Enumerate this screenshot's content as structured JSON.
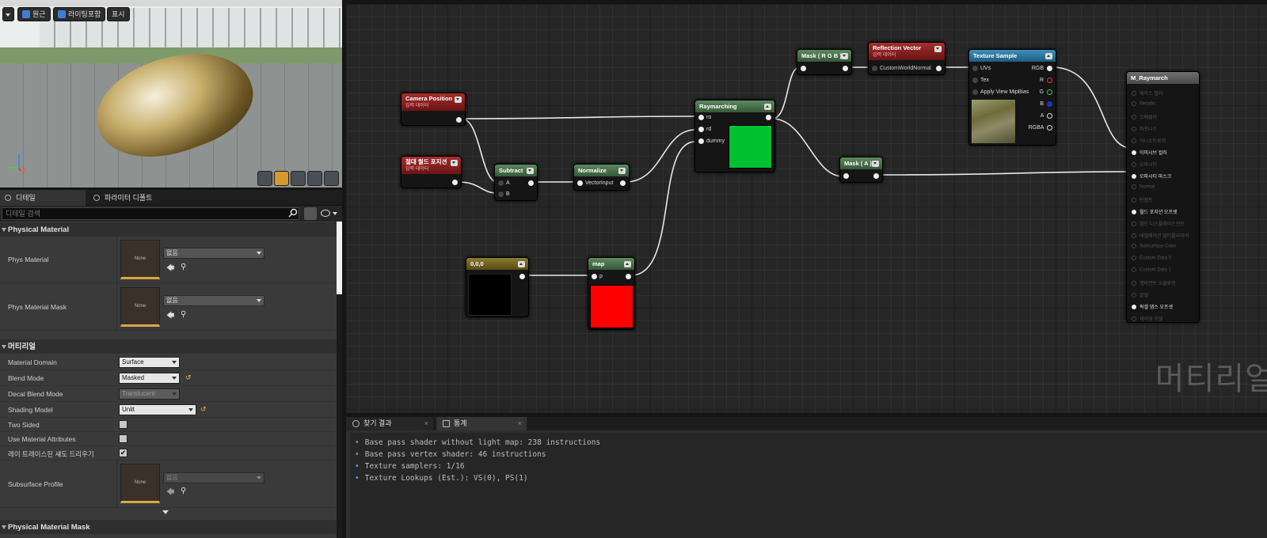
{
  "viewport": {
    "toolbar": {
      "perspective_label": "원근",
      "lighting_label": "라이팅포함",
      "show_label": "표시"
    },
    "axes": {
      "z": "Z",
      "x": "X"
    }
  },
  "panel_tabs": {
    "details": "디테일",
    "params": "파라미터 디폴트"
  },
  "search": {
    "placeholder": "디테일 검색"
  },
  "sections": {
    "physical_material": "Physical Material",
    "material": "머티리얼",
    "physical_material_mask": "Physical Material Mask"
  },
  "props": {
    "phys_material": {
      "label": "Phys Material",
      "thumb": "None",
      "value": "없음"
    },
    "phys_material_mask": {
      "label": "Phys Material Mask",
      "thumb": "None",
      "value": "없음"
    },
    "material_domain": {
      "label": "Material Domain",
      "value": "Surface"
    },
    "blend_mode": {
      "label": "Blend Mode",
      "value": "Masked"
    },
    "decal_blend_mode": {
      "label": "Decal Blend Mode",
      "value": "Translucent"
    },
    "shading_model": {
      "label": "Shading Model",
      "value": "Unlit"
    },
    "two_sided": {
      "label": "Two Sided",
      "checked": false
    },
    "use_material_attributes": {
      "label": "Use Material Attributes",
      "checked": false
    },
    "raytraced_shadows": {
      "label": "레이 트레이스된 섀도 드리우기",
      "checked": true,
      "mark": "✔"
    },
    "subsurface_profile": {
      "label": "Subsurface Profile",
      "thumb": "None",
      "value": "없음"
    }
  },
  "nodes": {
    "camera_position": {
      "title": "Camera Position",
      "subtitle": "입력 데이터"
    },
    "absolute_world_position": {
      "title": "절대 월드 포지션",
      "subtitle": "입력 데이터"
    },
    "subtract": {
      "title": "Subtract",
      "pin_a": "A",
      "pin_b": "B"
    },
    "normalize": {
      "title": "Normalize",
      "pin_in": "VectorInput"
    },
    "raymarching": {
      "title": "Raymarching",
      "pins": [
        "ro",
        "rd",
        "dummy"
      ],
      "preview_color": "#00c230"
    },
    "mask_rgb": {
      "title": "Mask ( R G B )"
    },
    "mask_a": {
      "title": "Mask ( A )"
    },
    "reflection_vector": {
      "title": "Reflection Vector",
      "subtitle": "입력 데이터",
      "pin_in": "CustomWorldNormal"
    },
    "texture_sample": {
      "title": "Texture Sample",
      "inputs": [
        "UVs",
        "Tex",
        "Apply View MipBias"
      ],
      "outputs": [
        "RGB",
        "R",
        "G",
        "B",
        "A",
        "RGBA"
      ]
    },
    "constant": {
      "title": "0,0,0",
      "preview_color": "#000000"
    },
    "map": {
      "title": "map",
      "pin_in": "p",
      "preview_color": "#ff0000"
    },
    "m_raymarch": {
      "title": "M_Raymarch",
      "rows": [
        {
          "label": "베이스 컬러",
          "on": false
        },
        {
          "label": "Metallic",
          "on": false
        },
        {
          "label": "스페큘러",
          "on": false
        },
        {
          "label": "러프니스",
          "on": false
        },
        {
          "label": "아니소트로피",
          "on": false
        },
        {
          "label": "이미시브 컬러",
          "on": true
        },
        {
          "label": "오파시티",
          "on": false
        },
        {
          "label": "오파시티 마스크",
          "on": true
        },
        {
          "label": "Normal",
          "on": false
        },
        {
          "label": "탄젠트",
          "on": false
        },
        {
          "label": "월드 포지션 오프셋",
          "on": true
        },
        {
          "label": "월드 디스플레이스먼트",
          "on": false
        },
        {
          "label": "테셀레이션 멀티플라이어",
          "on": false
        },
        {
          "label": "Subsurface Color",
          "on": false
        },
        {
          "label": "Custom Data 0",
          "on": false
        },
        {
          "label": "Custom Data 1",
          "on": false
        },
        {
          "label": "앰비언트 오클루전",
          "on": false
        },
        {
          "label": "굴절",
          "on": false
        },
        {
          "label": "픽셀 뎁스 오프셋",
          "on": true
        },
        {
          "label": "셰이딩 모델",
          "on": false
        }
      ]
    }
  },
  "graph_watermark": "머티리얼",
  "bottom_tabs": {
    "find_results": "찾기 결과",
    "stats": "통계"
  },
  "stats": [
    "Base pass shader without light map: 238 instructions",
    "Base pass vertex shader: 46 instructions",
    "Texture samplers: 1/16",
    "Texture Lookups (Est.): VS(0), PS(1)"
  ]
}
